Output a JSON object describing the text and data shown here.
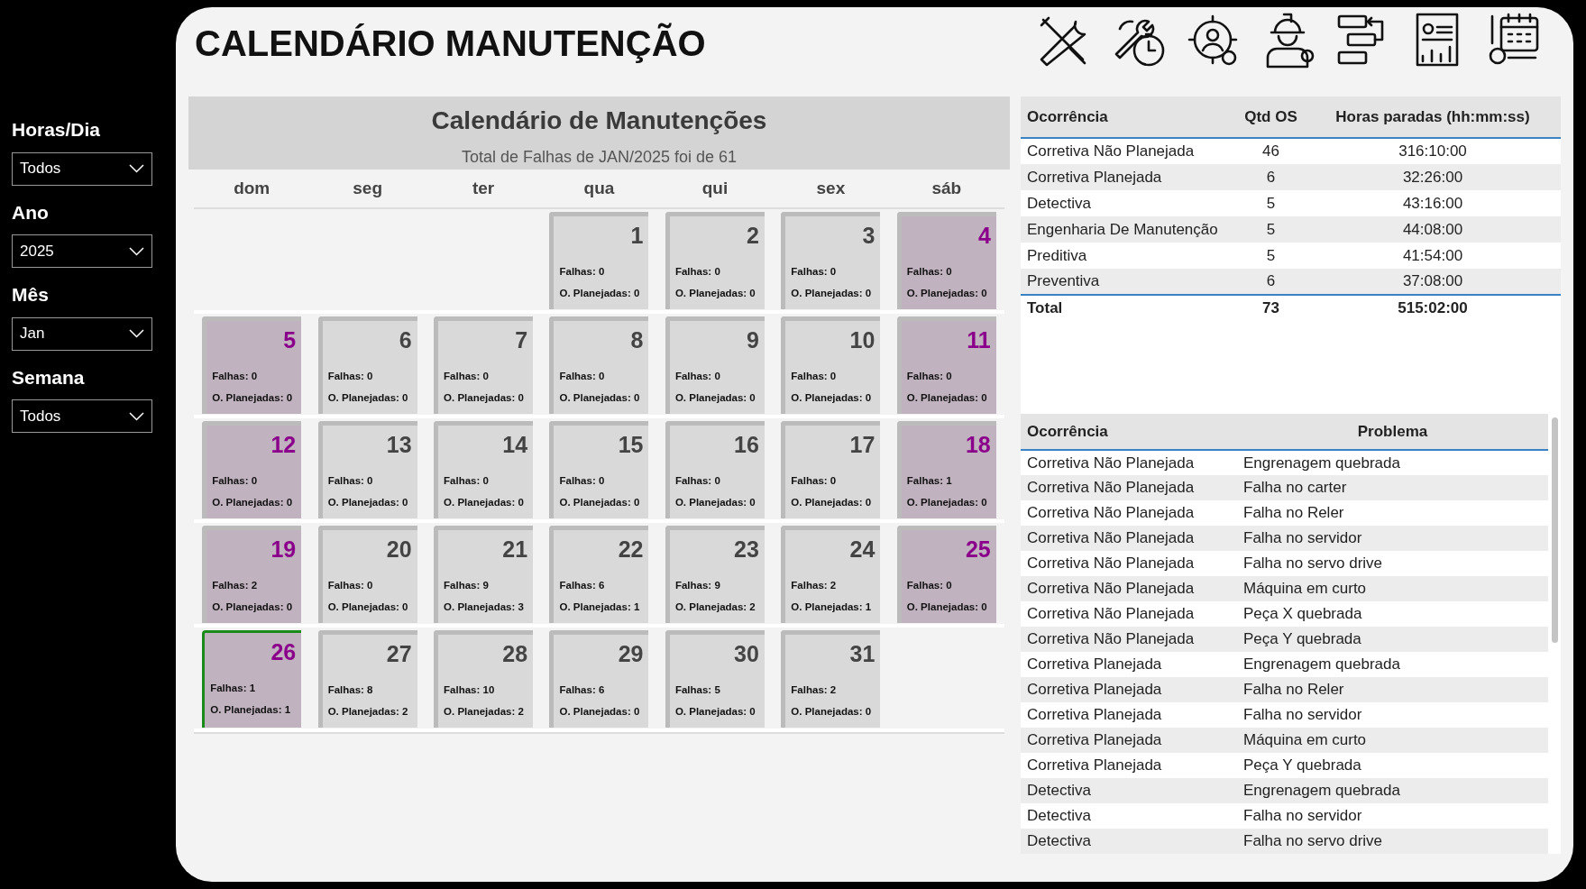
{
  "title": "CALENDÁRIO MANUTENÇÃO",
  "filters": [
    {
      "label": "Horas/Dia",
      "value": "Todos"
    },
    {
      "label": "Ano",
      "value": "2025"
    },
    {
      "label": "Mês",
      "value": "Jan"
    },
    {
      "label": "Semana",
      "value": "Todos"
    }
  ],
  "calendar": {
    "title": "Calendário de Manutenções",
    "subtitle": "Total de Falhas de JAN/2025 foi de 61",
    "weekdays": [
      "dom",
      "seg",
      "ter",
      "qua",
      "qui",
      "sex",
      "sáb"
    ],
    "cells": [
      {
        "kind": "blank"
      },
      {
        "kind": "blank"
      },
      {
        "kind": "blank"
      },
      {
        "kind": "day",
        "day": "1",
        "falhas": "Falhas: 0",
        "planejadas": "O. Planejadas: 0",
        "weekend": false,
        "selected": false
      },
      {
        "kind": "day",
        "day": "2",
        "falhas": "Falhas: 0",
        "planejadas": "O. Planejadas: 0",
        "weekend": false,
        "selected": false
      },
      {
        "kind": "day",
        "day": "3",
        "falhas": "Falhas: 0",
        "planejadas": "O. Planejadas: 0",
        "weekend": false,
        "selected": false
      },
      {
        "kind": "day",
        "day": "4",
        "falhas": "Falhas: 0",
        "planejadas": "O. Planejadas: 0",
        "weekend": true,
        "selected": false
      },
      {
        "kind": "day",
        "day": "5",
        "falhas": "Falhas: 0",
        "planejadas": "O. Planejadas: 0",
        "weekend": true,
        "selected": false
      },
      {
        "kind": "day",
        "day": "6",
        "falhas": "Falhas: 0",
        "planejadas": "O. Planejadas: 0",
        "weekend": false,
        "selected": false
      },
      {
        "kind": "day",
        "day": "7",
        "falhas": "Falhas: 0",
        "planejadas": "O. Planejadas: 0",
        "weekend": false,
        "selected": false
      },
      {
        "kind": "day",
        "day": "8",
        "falhas": "Falhas: 0",
        "planejadas": "O. Planejadas: 0",
        "weekend": false,
        "selected": false
      },
      {
        "kind": "day",
        "day": "9",
        "falhas": "Falhas: 0",
        "planejadas": "O. Planejadas: 0",
        "weekend": false,
        "selected": false
      },
      {
        "kind": "day",
        "day": "10",
        "falhas": "Falhas: 0",
        "planejadas": "O. Planejadas: 0",
        "weekend": false,
        "selected": false
      },
      {
        "kind": "day",
        "day": "11",
        "falhas": "Falhas: 0",
        "planejadas": "O. Planejadas: 0",
        "weekend": true,
        "selected": false
      },
      {
        "kind": "day",
        "day": "12",
        "falhas": "Falhas: 0",
        "planejadas": "O. Planejadas: 0",
        "weekend": true,
        "selected": false
      },
      {
        "kind": "day",
        "day": "13",
        "falhas": "Falhas: 0",
        "planejadas": "O. Planejadas: 0",
        "weekend": false,
        "selected": false
      },
      {
        "kind": "day",
        "day": "14",
        "falhas": "Falhas: 0",
        "planejadas": "O. Planejadas: 0",
        "weekend": false,
        "selected": false
      },
      {
        "kind": "day",
        "day": "15",
        "falhas": "Falhas: 0",
        "planejadas": "O. Planejadas: 0",
        "weekend": false,
        "selected": false
      },
      {
        "kind": "day",
        "day": "16",
        "falhas": "Falhas: 0",
        "planejadas": "O. Planejadas: 0",
        "weekend": false,
        "selected": false
      },
      {
        "kind": "day",
        "day": "17",
        "falhas": "Falhas: 0",
        "planejadas": "O. Planejadas: 0",
        "weekend": false,
        "selected": false
      },
      {
        "kind": "day",
        "day": "18",
        "falhas": "Falhas: 1",
        "planejadas": "O. Planejadas: 0",
        "weekend": true,
        "selected": false
      },
      {
        "kind": "day",
        "day": "19",
        "falhas": "Falhas: 2",
        "planejadas": "O. Planejadas: 0",
        "weekend": true,
        "selected": false
      },
      {
        "kind": "day",
        "day": "20",
        "falhas": "Falhas: 0",
        "planejadas": "O. Planejadas: 0",
        "weekend": false,
        "selected": false
      },
      {
        "kind": "day",
        "day": "21",
        "falhas": "Falhas: 9",
        "planejadas": "O. Planejadas: 3",
        "weekend": false,
        "selected": false
      },
      {
        "kind": "day",
        "day": "22",
        "falhas": "Falhas: 6",
        "planejadas": "O. Planejadas: 1",
        "weekend": false,
        "selected": false
      },
      {
        "kind": "day",
        "day": "23",
        "falhas": "Falhas: 9",
        "planejadas": "O. Planejadas: 2",
        "weekend": false,
        "selected": false
      },
      {
        "kind": "day",
        "day": "24",
        "falhas": "Falhas: 2",
        "planejadas": "O. Planejadas: 1",
        "weekend": false,
        "selected": false
      },
      {
        "kind": "day",
        "day": "25",
        "falhas": "Falhas: 0",
        "planejadas": "O. Planejadas: 0",
        "weekend": true,
        "selected": false
      },
      {
        "kind": "day",
        "day": "26",
        "falhas": "Falhas: 1",
        "planejadas": "O. Planejadas: 1",
        "weekend": true,
        "selected": true
      },
      {
        "kind": "day",
        "day": "27",
        "falhas": "Falhas: 8",
        "planejadas": "O. Planejadas: 2",
        "weekend": false,
        "selected": false
      },
      {
        "kind": "day",
        "day": "28",
        "falhas": "Falhas: 10",
        "planejadas": "O. Planejadas: 2",
        "weekend": false,
        "selected": false
      },
      {
        "kind": "day",
        "day": "29",
        "falhas": "Falhas: 6",
        "planejadas": "O. Planejadas: 0",
        "weekend": false,
        "selected": false
      },
      {
        "kind": "day",
        "day": "30",
        "falhas": "Falhas: 5",
        "planejadas": "O. Planejadas: 0",
        "weekend": false,
        "selected": false
      },
      {
        "kind": "day",
        "day": "31",
        "falhas": "Falhas: 2",
        "planejadas": "O. Planejadas: 0",
        "weekend": false,
        "selected": false
      },
      {
        "kind": "blank"
      }
    ]
  },
  "summary_table": {
    "columns": [
      "Ocorrência",
      "Qtd OS",
      "Horas paradas (hh:mm:ss)"
    ],
    "rows": [
      [
        "Corretiva Não Planejada",
        "46",
        "316:10:00"
      ],
      [
        "Corretiva Planejada",
        "6",
        "32:26:00"
      ],
      [
        "Detectiva",
        "5",
        "43:16:00"
      ],
      [
        "Engenharia De Manutenção",
        "5",
        "44:08:00"
      ],
      [
        "Preditiva",
        "5",
        "41:54:00"
      ],
      [
        "Preventiva",
        "6",
        "37:08:00"
      ]
    ],
    "total": [
      "Total",
      "73",
      "515:02:00"
    ]
  },
  "problems_table": {
    "columns": [
      "Ocorrência",
      "Problema"
    ],
    "rows": [
      [
        "Corretiva Não Planejada",
        "Engrenagem quebrada"
      ],
      [
        "Corretiva Não Planejada",
        "Falha no carter"
      ],
      [
        "Corretiva Não Planejada",
        "Falha no Reler"
      ],
      [
        "Corretiva Não Planejada",
        "Falha no servidor"
      ],
      [
        "Corretiva Não Planejada",
        "Falha no servo drive"
      ],
      [
        "Corretiva Não Planejada",
        "Máquina em curto"
      ],
      [
        "Corretiva Não Planejada",
        "Peça X quebrada"
      ],
      [
        "Corretiva Não Planejada",
        "Peça Y quebrada"
      ],
      [
        "Corretiva Planejada",
        "Engrenagem quebrada"
      ],
      [
        "Corretiva Planejada",
        "Falha no Reler"
      ],
      [
        "Corretiva Planejada",
        "Falha no servidor"
      ],
      [
        "Corretiva Planejada",
        "Máquina em curto"
      ],
      [
        "Corretiva Planejada",
        "Peça Y quebrada"
      ],
      [
        "Detectiva",
        "Engrenagem quebrada"
      ],
      [
        "Detectiva",
        "Falha no servidor"
      ],
      [
        "Detectiva",
        "Falha no servo drive"
      ]
    ]
  }
}
